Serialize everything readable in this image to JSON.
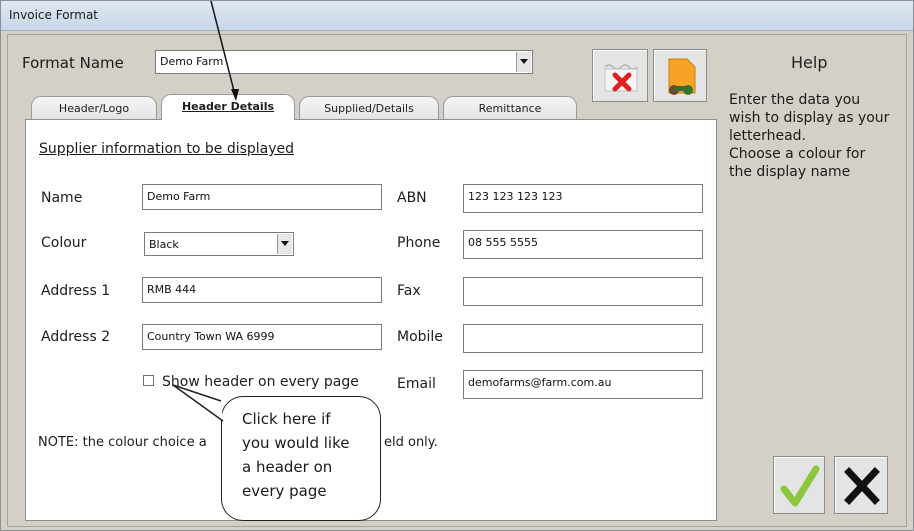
{
  "window": {
    "title": "Invoice Format"
  },
  "format": {
    "label": "Format Name",
    "value": "Demo Farm"
  },
  "tabs": [
    {
      "label": "Header/Logo"
    },
    {
      "label": "Header Details"
    },
    {
      "label": "Supplied/Details"
    },
    {
      "label": "Remittance"
    }
  ],
  "panel": {
    "section_title": "Supplier information to be displayed",
    "fields": {
      "name": {
        "label": "Name",
        "value": "Demo Farm"
      },
      "colour": {
        "label": "Colour",
        "value": "Black"
      },
      "address1": {
        "label": "Address 1",
        "value": "RMB 444"
      },
      "address2": {
        "label": "Address 2",
        "value": "Country Town WA 6999"
      },
      "abn": {
        "label": "ABN",
        "value": "123 123 123 123"
      },
      "phone": {
        "label": "Phone",
        "value": "08 555 5555"
      },
      "fax": {
        "label": "Fax",
        "value": ""
      },
      "mobile": {
        "label": "Mobile",
        "value": ""
      },
      "email": {
        "label": "Email",
        "value": "demofarms@farm.com.au"
      }
    },
    "checkbox": {
      "label": "Show header on every page",
      "checked": false
    },
    "note_left": "NOTE: the colour choice a",
    "note_right": "eld only."
  },
  "callout": {
    "lines": [
      "Click here if",
      "you would like",
      "a header on",
      "every page"
    ]
  },
  "help": {
    "title": "Help",
    "lines": [
      "Enter the data you",
      "wish to display as your",
      "letterhead.",
      "Choose a colour for",
      "the display name"
    ]
  },
  "icons": {
    "clear_format": "cancel-document-icon",
    "pick_format": "document-folder-icon",
    "ok": "checkmark-icon",
    "cancel": "x-icon"
  },
  "colors": {
    "ok_green": "#8cc63f",
    "cancel_red": "#e02020",
    "folder_orange": "#f7a326"
  }
}
